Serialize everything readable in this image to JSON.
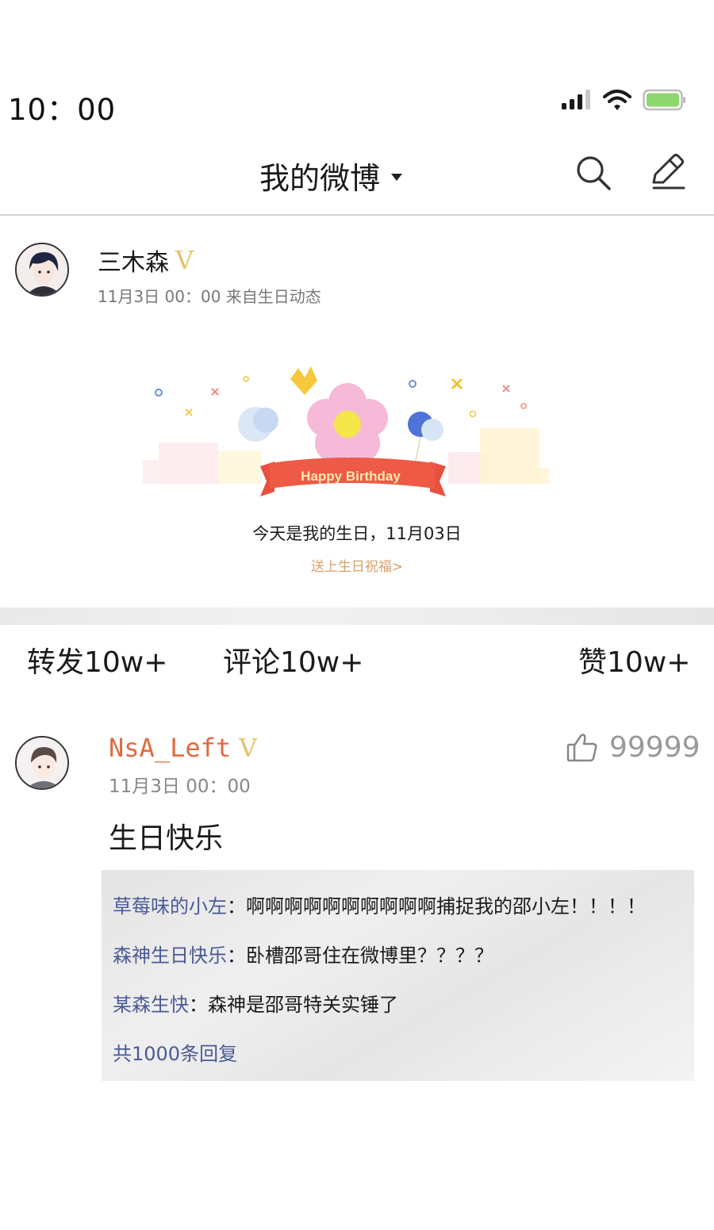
{
  "status_bar": {
    "time": "10：00",
    "icons": [
      "signal-icon",
      "wifi-icon",
      "battery-icon"
    ]
  },
  "header": {
    "title": "我的微博",
    "icons": [
      "search-icon",
      "edit-icon"
    ]
  },
  "post": {
    "author": "三木森",
    "verified_badge": "V",
    "meta": "11月3日 00：00 来自生日动态",
    "card": {
      "banner_text": "Happy Birthday",
      "message": "今天是我的生日，11月03日",
      "link": "送上生日祝福>"
    }
  },
  "actions": {
    "forward": "转发10w+",
    "comment": "评论10w+",
    "like": "赞10w+"
  },
  "comment": {
    "author": "NsA_Left",
    "verified_badge": "V",
    "meta": "11月3日 00：00",
    "likes": "99999",
    "text": "生日快乐",
    "replies": [
      {
        "who": "草莓味的小左",
        "sep": "：",
        "text": "啊啊啊啊啊啊啊啊啊啊捕捉我的邵小左！！！！"
      },
      {
        "who": "森神生日快乐",
        "sep": "：",
        "text": "卧槽邵哥住在微博里？？？？"
      },
      {
        "who": "某森生快",
        "sep": "：",
        "text": "森神是邵哥特关实锤了"
      }
    ],
    "more": "共1000条回复"
  },
  "colors": {
    "username_highlight": "#e06a40",
    "reply_name": "#4a5a95",
    "verified": "#e7c46a",
    "link": "#d9a06a",
    "battery": "#8fd66e"
  }
}
